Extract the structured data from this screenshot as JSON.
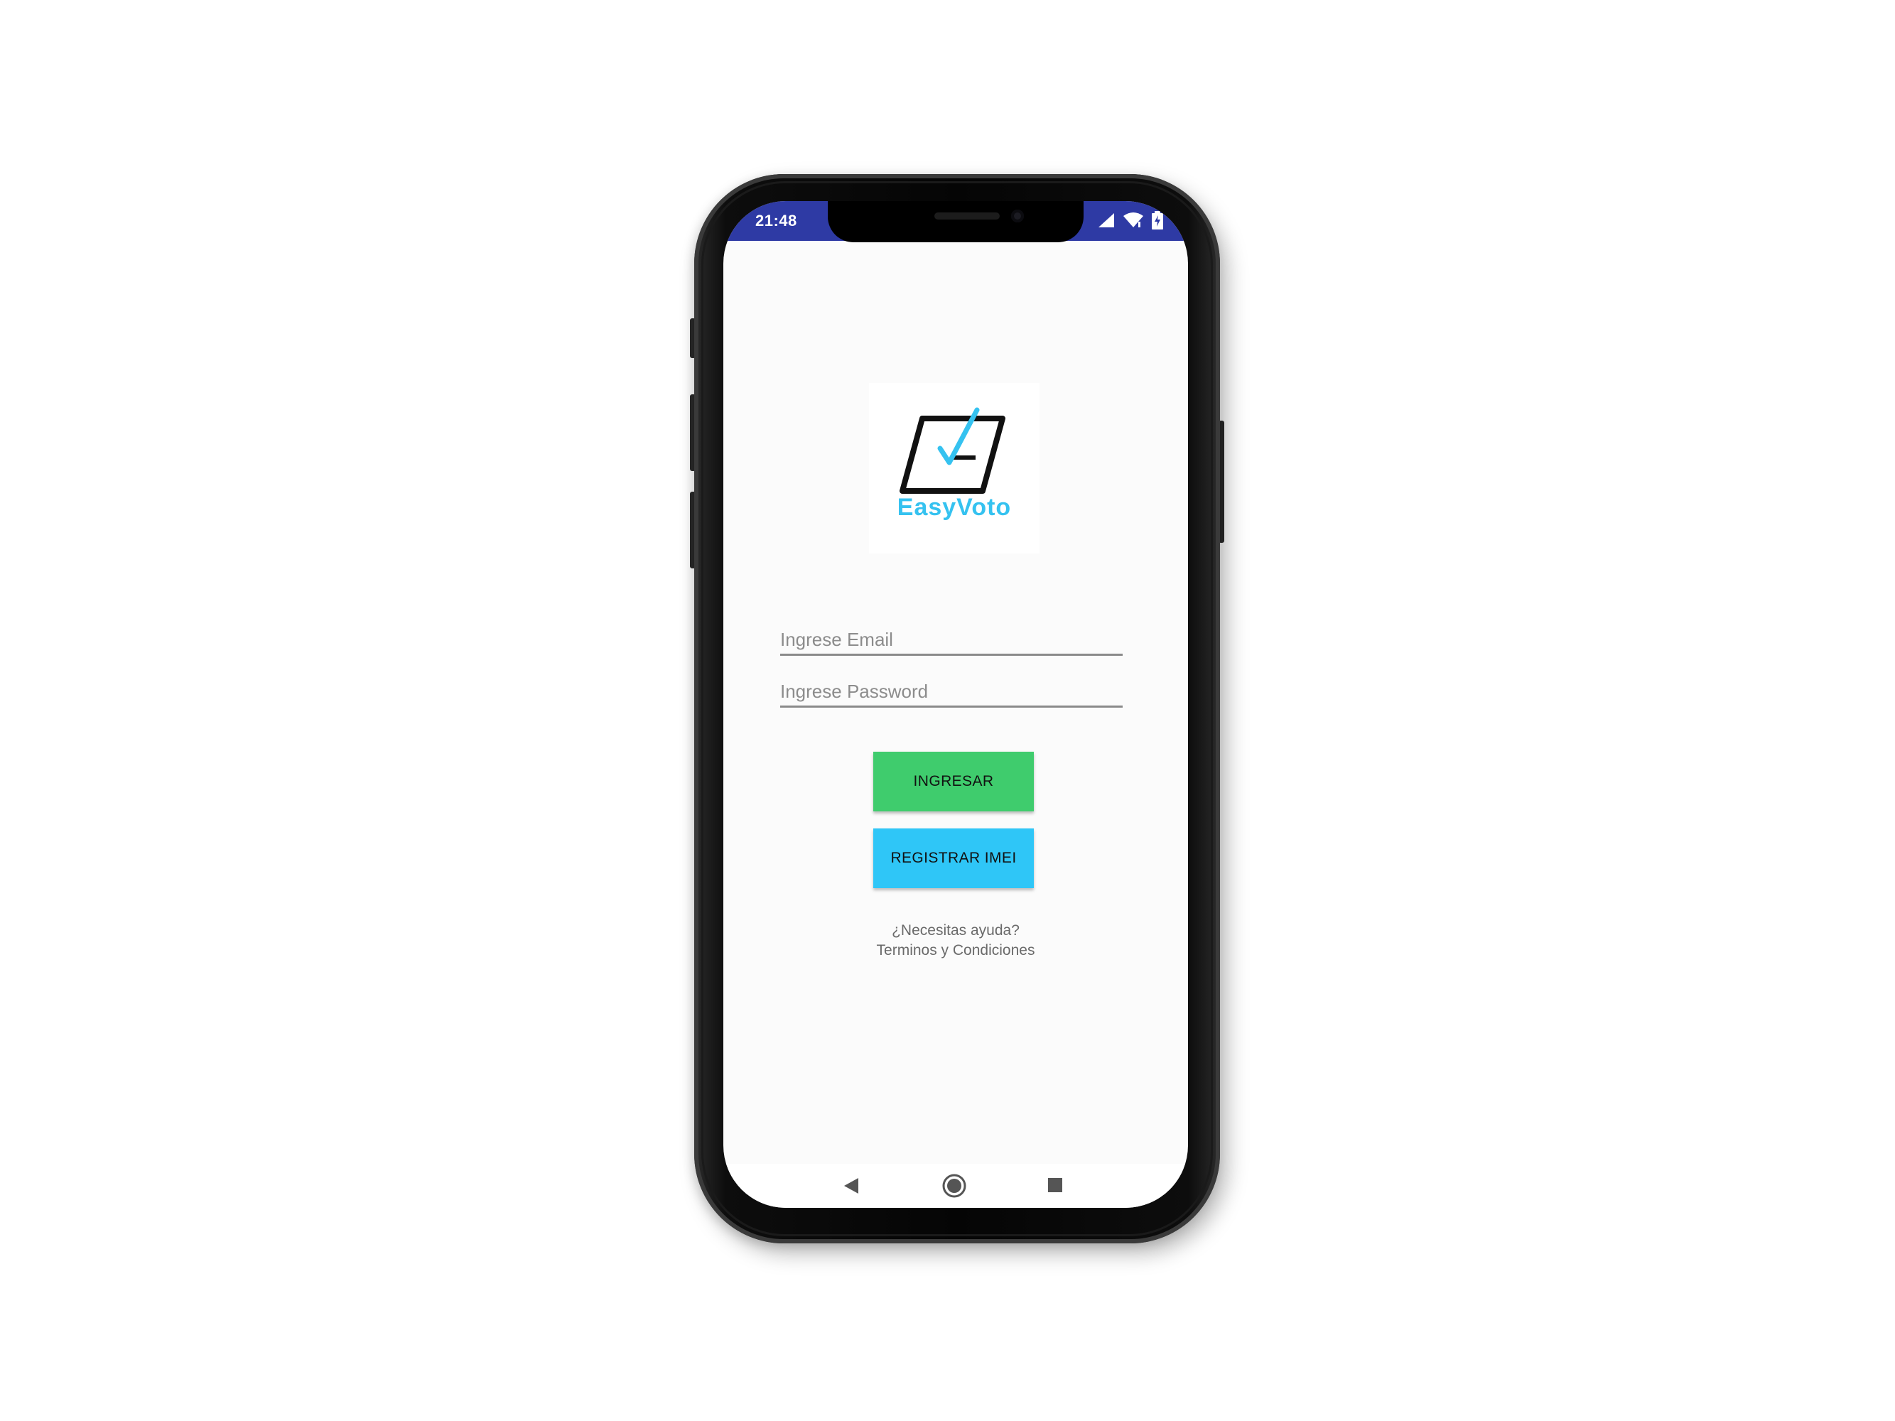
{
  "status_bar": {
    "time": "21:48",
    "icons": [
      "cell-signal-icon",
      "wifi-icon",
      "battery-icon"
    ],
    "color": "#2e3aa4"
  },
  "logo": {
    "text": "EasyVoto",
    "icon": "ballot-check-icon",
    "color": "#35c2f0"
  },
  "form": {
    "email_placeholder": "Ingrese Email",
    "password_placeholder": "Ingrese Password"
  },
  "buttons": {
    "login_label": "INGRESAR",
    "login_color": "#3fcc6d",
    "register_label": "REGISTRAR IMEI",
    "register_color": "#2fc6f7"
  },
  "links": {
    "help": "¿Necesitas ayuda?",
    "terms": "Terminos y Condiciones"
  },
  "nav_bar": {
    "icons": [
      "back-icon",
      "home-icon",
      "recents-icon"
    ]
  }
}
